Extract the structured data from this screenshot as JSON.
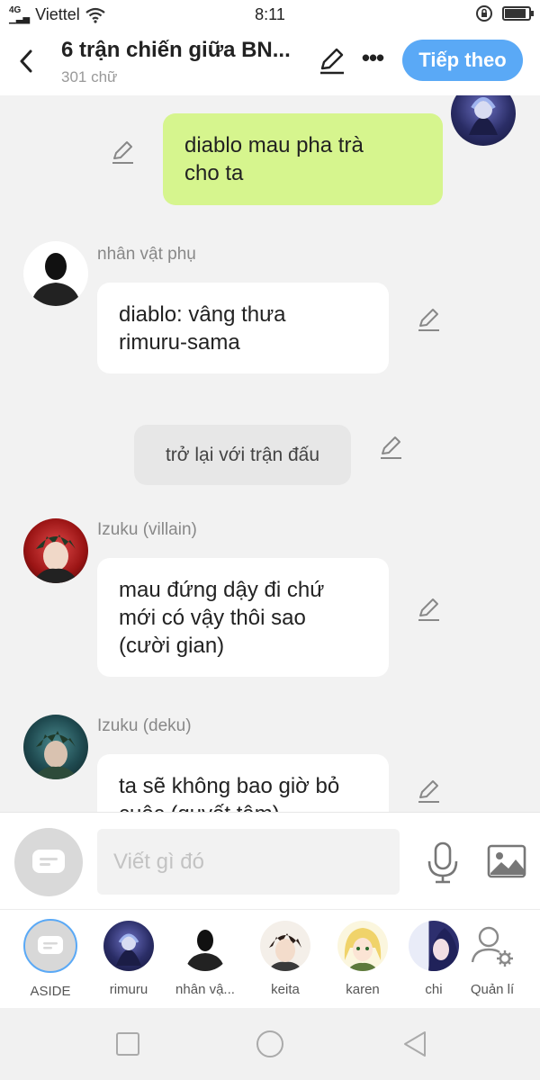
{
  "status_bar": {
    "network": "4G",
    "carrier": "Viettel",
    "time": "8:11",
    "battery_level": 0.9
  },
  "header": {
    "title": "6 trận chiến giữa BN...",
    "subtitle": "301 chữ",
    "next_label": "Tiếp theo"
  },
  "messages": [
    {
      "type": "own",
      "text": "diablo mau pha trà\ncho ta"
    },
    {
      "type": "character",
      "name": "nhân vật phụ",
      "text": "diablo: vâng thưa\nrimuru-sama"
    },
    {
      "type": "aside",
      "text": "trở lại với trận đấu"
    },
    {
      "type": "character",
      "name": "Izuku (villain)",
      "text": "mau đứng dậy đi chứ\nmới có vậy thôi sao\n(cười gian)"
    },
    {
      "type": "character",
      "name": "Izuku (deku)",
      "text": "ta sẽ không bao giờ bỏ\ncuộc (quyết tâm)"
    }
  ],
  "composer": {
    "placeholder": "Viết gì đó"
  },
  "characters": [
    {
      "label": "ASIDE"
    },
    {
      "label": "rimuru"
    },
    {
      "label": "nhân vậ..."
    },
    {
      "label": "keita"
    },
    {
      "label": "karen"
    },
    {
      "label": "chi"
    },
    {
      "label": "Quản lí"
    }
  ],
  "colors": {
    "accent": "#5aa9f6",
    "own_bubble": "#d6f58e",
    "background": "#f2f2f2"
  }
}
